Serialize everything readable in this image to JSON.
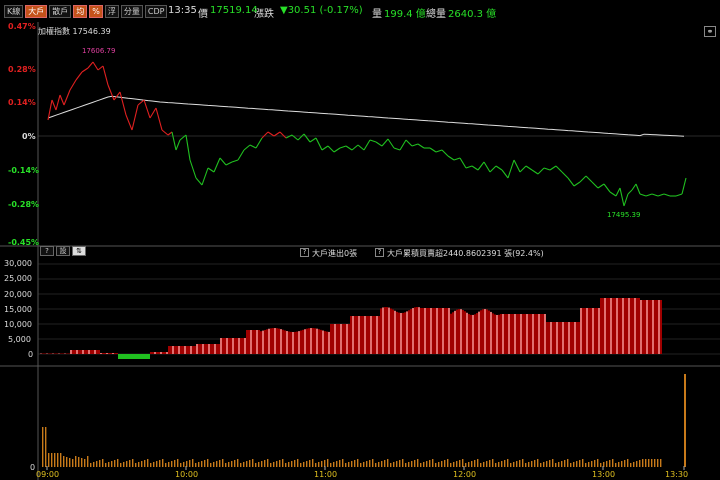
{
  "toolbar": {
    "tabs": [
      {
        "label": "K線",
        "active": false
      },
      {
        "label": "大戶",
        "active": true
      },
      {
        "label": "散戶",
        "active": false
      },
      {
        "label": "均",
        "active": true
      },
      {
        "label": "%",
        "active": true
      },
      {
        "label": "浮",
        "active": false
      },
      {
        "label": "分量",
        "active": false
      },
      {
        "label": "CDP",
        "active": false
      }
    ],
    "time": "13:35",
    "price_label": "價",
    "price": "17519.14",
    "change_label": "漲跌",
    "change": "▼30.51 (-0.17%)",
    "volume_label": "量",
    "volume": "199.4 億",
    "total_label": "總量",
    "total": "2640.3 億"
  },
  "main_chart": {
    "title": "加權指數 17546.39",
    "y_labels": [
      "0.47%",
      "0.28%",
      "0.14%",
      "0%",
      "-0.14%",
      "-0.28%",
      "-0.45%"
    ],
    "high_label": "17606.79",
    "low_label": "17495.39"
  },
  "sub_panel": {
    "buttons": [
      "?",
      "設",
      "⇅"
    ],
    "info1_icon": "?",
    "info1": "大戶進出0張",
    "info2_icon": "?",
    "info2": "大戶累積買賣超2440.8602391 張(92.4%)",
    "y_labels": [
      "30,000",
      "25,000",
      "20,000",
      "15,000",
      "10,000",
      "5,000",
      "0"
    ]
  },
  "volume_panel": {
    "zero_label": "0"
  },
  "x_axis": [
    "09:00",
    "10:00",
    "11:00",
    "12:00",
    "13:00",
    "13:30"
  ],
  "colors": {
    "up": "#e02020",
    "down": "#20c020",
    "ma": "#dddddd",
    "bar_light": "#e07070",
    "bar_dark": "#a00000",
    "vol": "#c87a1a"
  }
}
